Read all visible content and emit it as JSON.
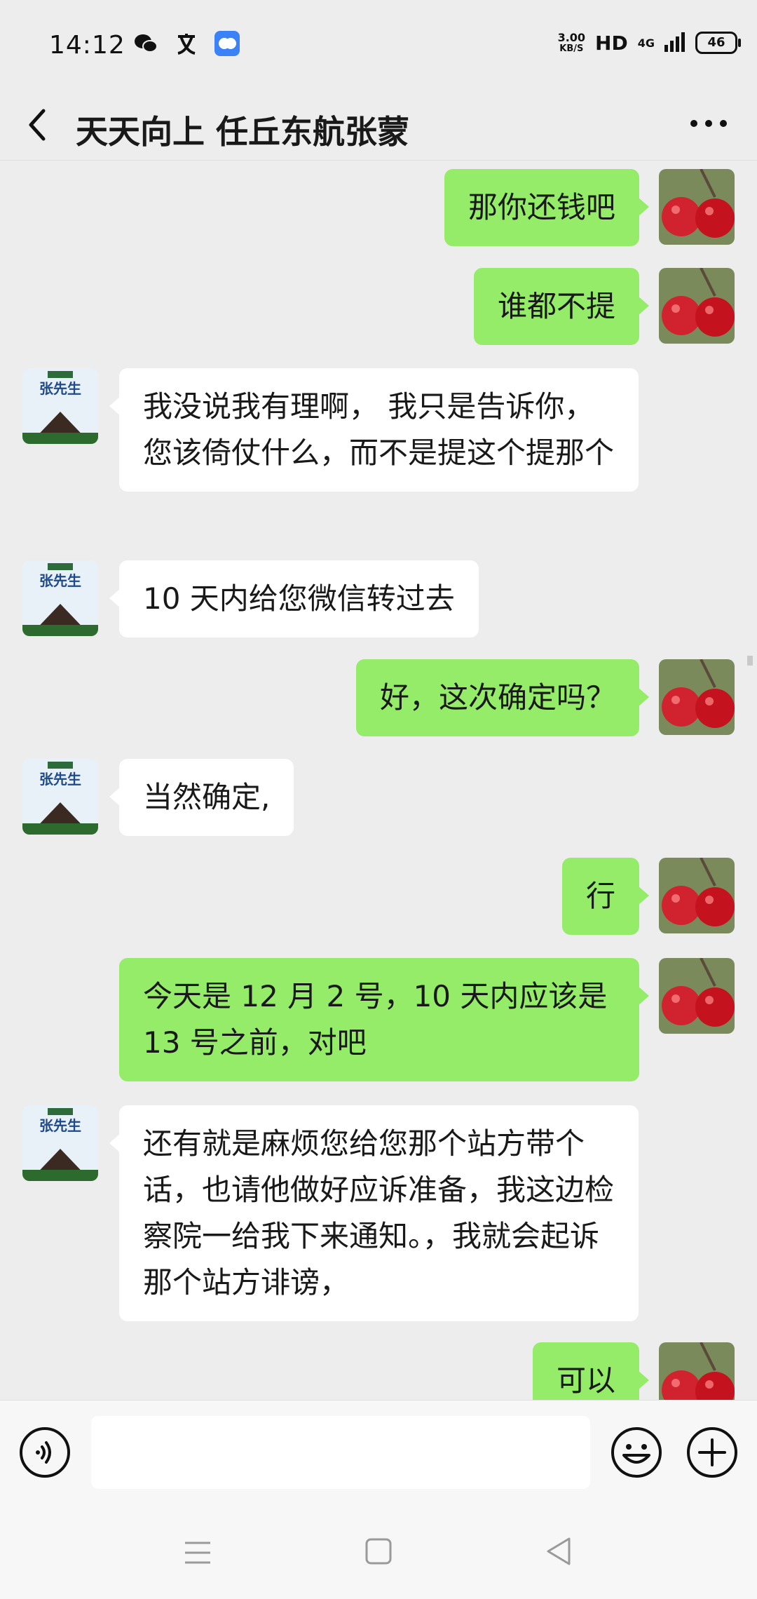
{
  "status_bar": {
    "time": "14:12",
    "speed_value": "3.00",
    "speed_unit": "KB/S",
    "hd": "HD",
    "network": "4G",
    "battery": "46"
  },
  "header": {
    "title": "天天向上 任丘东航张蒙"
  },
  "avatars": {
    "them_name": "张先生"
  },
  "messages": [
    {
      "from": "me",
      "text": "那你还钱吧"
    },
    {
      "from": "me",
      "text": "谁都不提"
    },
    {
      "from": "them",
      "text": "我没说我有理啊， 我只是告诉你，您该倚仗什么，而不是提这个提那个"
    },
    {
      "from": "them",
      "text": "10 天内给您微信转过去"
    },
    {
      "from": "me",
      "text": "好，这次确定吗？"
    },
    {
      "from": "them",
      "text": "当然确定,"
    },
    {
      "from": "me",
      "text": "行"
    },
    {
      "from": "me",
      "text": "今天是 12 月 2 号，10 天内应该是 13 号之前，对吧"
    },
    {
      "from": "them",
      "text": "还有就是麻烦您给您那个站方带个话，也请他做好应诉准备，我这边检察院一给我下来通知。，我就会起诉那个站方诽谤，"
    },
    {
      "from": "me",
      "text": "可以"
    }
  ],
  "input": {
    "value": "",
    "placeholder": ""
  },
  "colors": {
    "background": "#ededed",
    "my_bubble": "#95ec69",
    "their_bubble": "#ffffff",
    "input_bar": "#f7f7f7"
  }
}
